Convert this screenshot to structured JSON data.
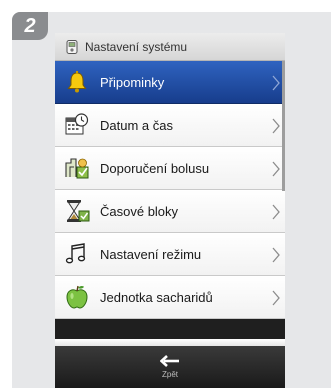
{
  "step": "2",
  "header": {
    "title": "Nastavení systému",
    "icon": "meter-icon"
  },
  "menu": [
    {
      "label": "Připominky",
      "icon": "bell-icon",
      "active": true
    },
    {
      "label": "Datum a čas",
      "icon": "calendar-clock-icon",
      "active": false
    },
    {
      "label": "Doporučení bolusu",
      "icon": "bolus-advice-icon",
      "active": false
    },
    {
      "label": "Časové bloky",
      "icon": "hourglass-icon",
      "active": false
    },
    {
      "label": "Nastavení režimu",
      "icon": "music-note-icon",
      "active": false
    },
    {
      "label": "Jednotka sacharidů",
      "icon": "apple-icon",
      "active": false
    }
  ],
  "footer": {
    "back_label": "Zpět",
    "icon": "back-arrow-icon"
  },
  "colors": {
    "accent": "#1f4fa6",
    "panel": "#e6e7e9",
    "badge": "#8a8c8f"
  }
}
